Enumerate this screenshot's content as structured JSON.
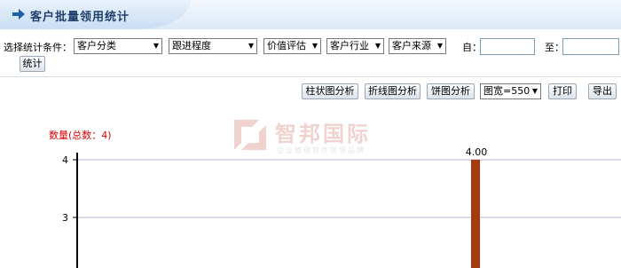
{
  "header": {
    "title": "客户批量领用统计"
  },
  "filters": {
    "label": "选择统计条件：",
    "selects": [
      {
        "value": "客户分类"
      },
      {
        "value": "跟进程度"
      },
      {
        "value": "价值评估"
      },
      {
        "value": "客户行业"
      },
      {
        "value": "客户来源"
      }
    ],
    "from_label": "自：",
    "to_label": "至：",
    "from_value": "",
    "to_value": "",
    "stat_button": "统计"
  },
  "toolbar": {
    "bar_button": "柱状图分析",
    "line_button": "折线图分析",
    "pie_button": "饼图分析",
    "width_select": "图宽=550",
    "print_button": "打印",
    "export_button": "导出"
  },
  "watermark": {
    "name": "智邦国际",
    "subtitle": "企业管理软件领导品牌"
  },
  "colors": {
    "bar": "#a5380f",
    "grid": "#b9b3d8",
    "title_red": "#e00000",
    "header_text": "#1f3f6b"
  },
  "chart_data": {
    "type": "bar",
    "title": "数量(总数：4)",
    "categories": [
      ""
    ],
    "values": [
      4
    ],
    "data_labels": [
      "4.00"
    ],
    "y_ticks": [
      4,
      3
    ],
    "ylim": [
      2.8,
      4
    ]
  }
}
